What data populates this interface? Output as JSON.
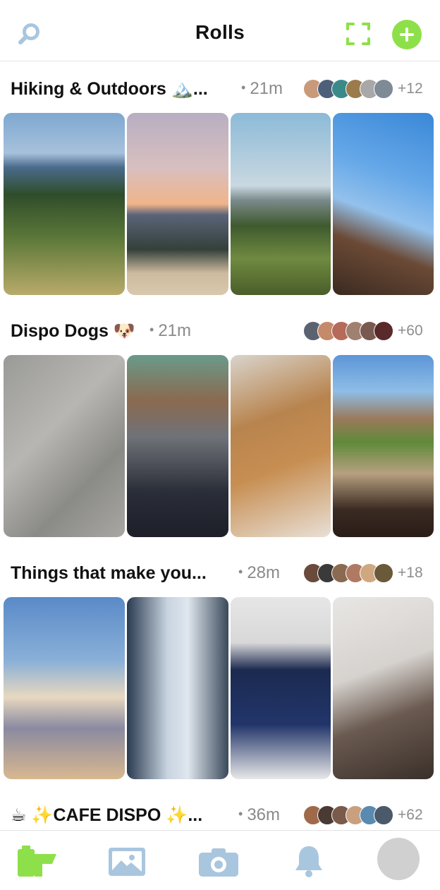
{
  "header": {
    "title": "Rolls"
  },
  "colors": {
    "accent": "#8ee04a",
    "muted": "#8a8a8a",
    "icon_blue": "#a9c6df"
  },
  "icons": {
    "search": "search-icon",
    "expand": "expand-icon",
    "add": "plus-icon",
    "tabs": [
      "film-roll-icon",
      "gallery-icon",
      "camera-icon",
      "bell-icon",
      "profile-avatar"
    ]
  },
  "rolls": [
    {
      "title": "Hiking & Outdoors 🏔️...",
      "time": "21m",
      "count": "+12",
      "photos": [
        "mountain hills",
        "sunset city view",
        "observatory hillside",
        "rock cliff sky"
      ]
    },
    {
      "title": "Dispo Dogs 🐶",
      "time": "21m",
      "count": "+60",
      "photos": [
        "french bulldog sweater",
        "person with bulldog",
        "sleeping dog",
        "dog at beach rocks"
      ]
    },
    {
      "title": "Things that make you...",
      "time": "28m",
      "count": "+18",
      "photos": [
        "clouds sky",
        "plant by window",
        "blue window room",
        "string lights curtain"
      ]
    },
    {
      "title": "☕ ✨CAFE DISPO ✨...",
      "time": "36m",
      "count": "+62",
      "photos": []
    }
  ]
}
